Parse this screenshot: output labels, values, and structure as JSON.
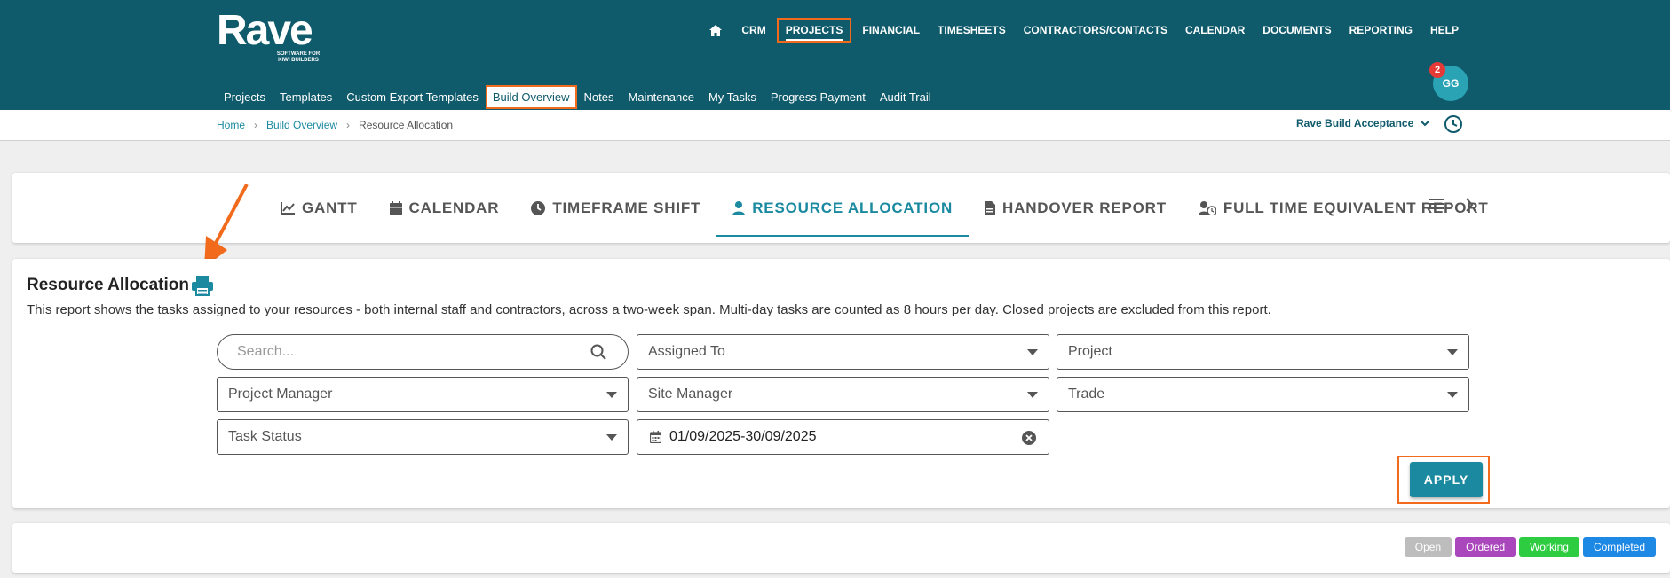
{
  "logo": {
    "word": "Rave",
    "tagline": "SOFTWARE FOR KIWI BUILDERS"
  },
  "main_nav": {
    "home_icon": "home-icon",
    "items": [
      "CRM",
      "PROJECTS",
      "FINANCIAL",
      "TIMESHEETS",
      "CONTRACTORS/CONTACTS",
      "CALENDAR",
      "DOCUMENTS",
      "REPORTING",
      "HELP"
    ],
    "active": "PROJECTS"
  },
  "sub_nav": {
    "items": [
      "Projects",
      "Templates",
      "Custom Export Templates",
      "Build Overview",
      "Notes",
      "Maintenance",
      "My Tasks",
      "Progress Payment",
      "Audit Trail"
    ],
    "active": "Build Overview"
  },
  "user": {
    "initials": "GG",
    "notifications": "2"
  },
  "breadcrumb": {
    "home": "Home",
    "section": "Build Overview",
    "current": "Resource Allocation"
  },
  "workspace": {
    "label": "Rave Build Acceptance"
  },
  "tabs": [
    {
      "label": "GANTT",
      "icon": "line-chart-icon"
    },
    {
      "label": "CALENDAR",
      "icon": "calendar-icon"
    },
    {
      "label": "TIMEFRAME SHIFT",
      "icon": "clock-icon"
    },
    {
      "label": "RESOURCE ALLOCATION",
      "icon": "person-icon"
    },
    {
      "label": "HANDOVER REPORT",
      "icon": "document-icon"
    },
    {
      "label": "FULL TIME EQUIVALENT REPORT",
      "icon": "user-clock-icon"
    }
  ],
  "active_tab": "RESOURCE ALLOCATION",
  "report": {
    "title": "Resource Allocation",
    "description": "This report shows the tasks assigned to your resources - both internal staff and contractors, across a two-week span. Multi-day tasks are counted as 8 hours per day. Closed projects are excluded from this report."
  },
  "filters": {
    "search_placeholder": "Search...",
    "assigned_to": "Assigned To",
    "project": "Project",
    "project_manager": "Project Manager",
    "site_manager": "Site Manager",
    "trade": "Trade",
    "task_status": "Task Status",
    "date_range": "01/09/2025-30/09/2025"
  },
  "apply_label": "APPLY",
  "legend": [
    {
      "label": "Open",
      "color": "#bdbdbd"
    },
    {
      "label": "Ordered",
      "color": "#ab47bc"
    },
    {
      "label": "Working",
      "color": "#2ecc40"
    },
    {
      "label": "Completed",
      "color": "#1e88e5"
    }
  ],
  "colors": {
    "header": "#0f5a6b",
    "accent": "#1b8aa0",
    "highlight": "#f26b1d"
  }
}
